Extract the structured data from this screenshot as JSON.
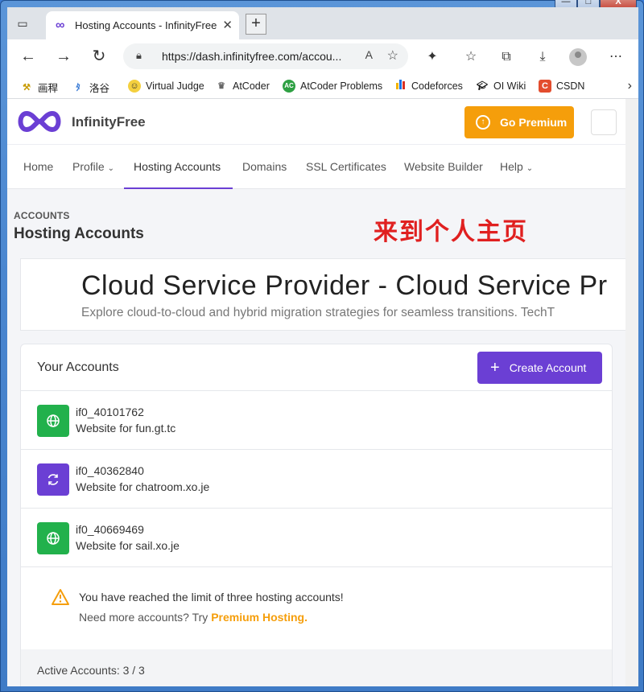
{
  "browser": {
    "tab_title": "Hosting Accounts - InfinityFree",
    "new_tab_symbol": "+",
    "url": "https://dash.infinityfree.com/accou...",
    "window_controls": {
      "minimize": "—",
      "maximize": "□",
      "close": "X"
    }
  },
  "bookmarks": [
    {
      "label": "画稈",
      "icon": "bookmark-icon"
    },
    {
      "label": "洛谷",
      "icon": "luogu-icon"
    },
    {
      "label": "Virtual Judge",
      "icon": "vjudge-icon"
    },
    {
      "label": "AtCoder",
      "icon": "atcoder-icon"
    },
    {
      "label": "AtCoder Problems",
      "icon": "atcoder-problems-icon"
    },
    {
      "label": "Codeforces",
      "icon": "codeforces-icon"
    },
    {
      "label": "OI Wiki",
      "icon": "oiwiki-icon"
    },
    {
      "label": "CSDN",
      "icon": "csdn-icon"
    }
  ],
  "site": {
    "logo_text": "InfinityFree",
    "premium_button": "Go Premium",
    "nav": [
      {
        "label": "Home"
      },
      {
        "label": "Profile"
      },
      {
        "label": "Hosting Accounts"
      },
      {
        "label": "Domains"
      },
      {
        "label": "SSL Certificates"
      },
      {
        "label": "Website Builder"
      },
      {
        "label": "Help"
      }
    ]
  },
  "header": {
    "breadcrumb": "ACCOUNTS",
    "title": "Hosting Accounts",
    "annotation": "来到个人主页"
  },
  "ad": {
    "title": "Cloud Service Provider - Cloud Service Pr",
    "subtitle": "Explore cloud-to-cloud and hybrid migration strategies for seamless transitions. TechT"
  },
  "accounts_card": {
    "title": "Your Accounts",
    "create_button": "Create Account",
    "accounts": [
      {
        "name": "if0_40101762",
        "website": "Website for fun.gt.tc",
        "status_icon": "globe-icon",
        "status_color": "#22b14c"
      },
      {
        "name": "if0_40362840",
        "website": "Website for chatroom.xo.je",
        "status_icon": "sync-icon",
        "status_color": "#6b3fd4"
      },
      {
        "name": "if0_40669469",
        "website": "Website for sail.xo.je",
        "status_icon": "globe-icon",
        "status_color": "#22b14c"
      }
    ],
    "notice": {
      "line1": "You have reached the limit of three hosting accounts!",
      "line2_prefix": "Need more accounts? Try ",
      "line2_link": "Premium Hosting."
    },
    "footer": "Active Accounts: 3 / 3"
  },
  "colors": {
    "brand_purple": "#6b3fd4",
    "premium_orange": "#f59e0b",
    "active_green": "#22b14c",
    "annotation_red": "#e02020"
  }
}
